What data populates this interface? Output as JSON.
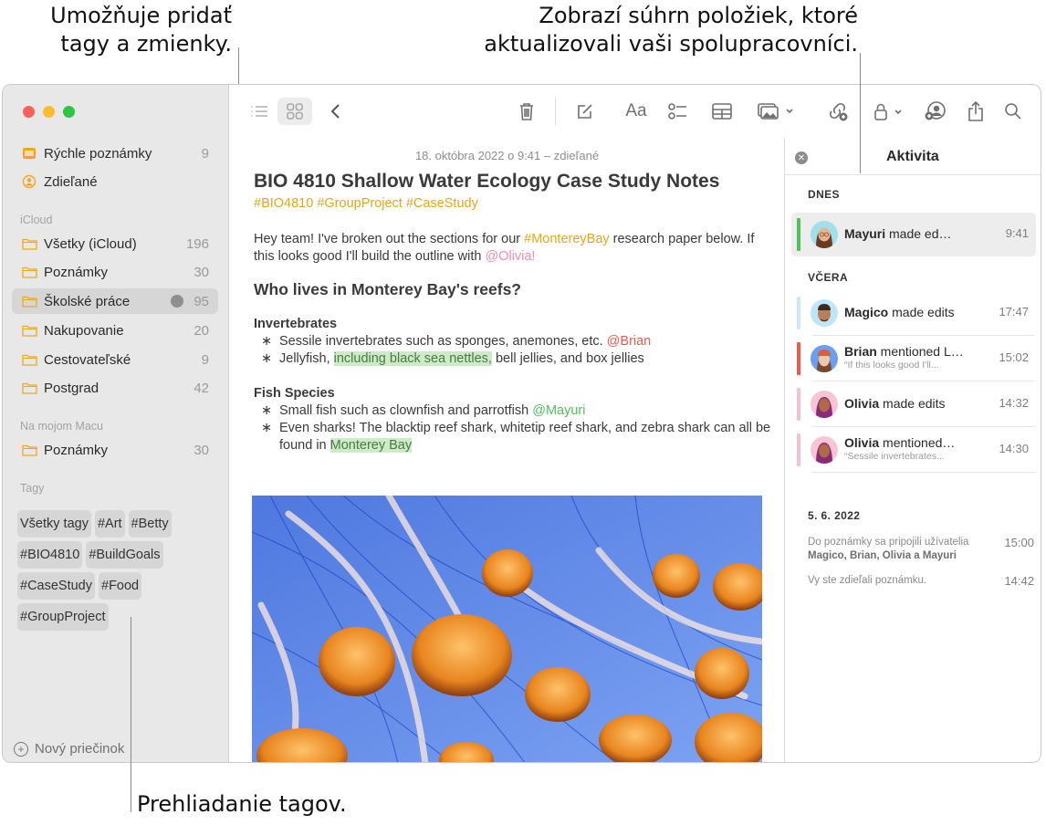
{
  "callouts": {
    "top_left": [
      "Umožňuje pridať",
      "tagy a zmienky."
    ],
    "top_right": [
      "Zobrazí súhrn položiek, ktoré",
      "aktualizovali vaši spolupracovníci."
    ],
    "bottom": "Prehliadanie tagov."
  },
  "sidebar": {
    "items_top": [
      {
        "label": "Rýchle poznámky",
        "count": "9",
        "icon": "quick-note-icon"
      },
      {
        "label": "Zdieľané",
        "count": "",
        "icon": "shared-person-icon"
      }
    ],
    "icloud_label": "iCloud",
    "icloud_folders": [
      {
        "label": "Všetky (iCloud)",
        "count": "196"
      },
      {
        "label": "Poznámky",
        "count": "30"
      },
      {
        "label": "Školské práce",
        "count": "95",
        "shared": true,
        "active": true
      },
      {
        "label": "Nakupovanie",
        "count": "20"
      },
      {
        "label": "Cestovateľské",
        "count": "9"
      },
      {
        "label": "Postgrad",
        "count": "42"
      }
    ],
    "mac_label": "Na mojom Macu",
    "mac_folders": [
      {
        "label": "Poznámky",
        "count": "30"
      }
    ],
    "tags_label": "Tagy",
    "tags": [
      "Všetky tagy",
      "#Art",
      "#Betty",
      "#BIO4810",
      "#BuildGoals",
      "#CaseStudy",
      "#Food",
      "#GroupProject"
    ],
    "new_folder": "Nový priečinok"
  },
  "toolbar": {
    "icons": [
      "list-view-icon",
      "gallery-view-icon",
      "back-icon",
      "trash-icon",
      "compose-icon",
      "format-text-icon",
      "checklist-icon",
      "table-icon",
      "media-icon",
      "collaborate-link-icon",
      "lock-icon",
      "share-person-icon",
      "share-icon",
      "search-icon"
    ],
    "format_label": "Aa"
  },
  "note": {
    "date": "18. októbra 2022 o 9:41 – zdieľané",
    "title": "BIO 4810 Shallow Water Ecology Case Study Notes",
    "tags": "#BIO4810 #GroupProject #CaseStudy",
    "intro": {
      "p1": "Hey team! I've broken out the sections for our ",
      "tag": "#MontereyBay",
      "p2": " research paper below. If this looks good I'll build the outline with ",
      "mention": "@Olivia!"
    },
    "heading": "Who lives in Monterey Bay's reefs?",
    "sections": [
      {
        "title": "Invertebrates",
        "bullets": [
          {
            "pre": "Sessile invertebrates such as sponges, anemones, etc. ",
            "mention": "@Brian"
          },
          {
            "pre": "Jellyfish, ",
            "highlight": "including black sea nettles,",
            "post": " bell jellies, and box jellies"
          }
        ]
      },
      {
        "title": "Fish Species",
        "bullets": [
          {
            "pre": "Small fish such as clownfish and parrotfish ",
            "mention": "@Mayuri"
          },
          {
            "pre": "Even sharks! The blacktip reef shark, whitetip reef shark, and zebra shark can all be found in ",
            "highlight": "Monterey Bay"
          }
        ]
      }
    ],
    "image_alt": "jellyfish-photo"
  },
  "activity": {
    "title": "Aktivita",
    "today_label": "DNES",
    "today": [
      {
        "name": "Mayuri",
        "action": " made ed…",
        "time": "9:41",
        "color": "#4fc15b",
        "avatar_bg": "#9fe0ec",
        "selected": true
      }
    ],
    "yesterday_label": "VČERA",
    "yesterday": [
      {
        "name": "Magico",
        "action": " made edits",
        "time": "17:47",
        "color": "#c9e9fb",
        "avatar_bg": "#bfe6f7"
      },
      {
        "name": "Brian",
        "action": " mentioned L…",
        "sub": "“If this looks good I'll...",
        "time": "15:02",
        "color": "#ee5a4f",
        "avatar_bg": "#6c9ff0"
      },
      {
        "name": "Olivia",
        "action": " made edits",
        "time": "14:32",
        "color": "#f7bfd0",
        "avatar_bg": "#f7c5d3"
      },
      {
        "name": "Olivia",
        "action": " mentioned…",
        "sub": "“Sessile invertebrates...",
        "time": "14:30",
        "color": "#f7bfd0",
        "avatar_bg": "#f7c5d3"
      }
    ],
    "date_label": "5. 6. 2022",
    "history": [
      {
        "text": "Do poznámky sa pripojili užívatelia",
        "bold": "Magico, Brian, Olivia a Mayuri",
        "time": "15:00"
      },
      {
        "text": "Vy ste zdieľali poznámku.",
        "time": "14:42"
      }
    ]
  }
}
